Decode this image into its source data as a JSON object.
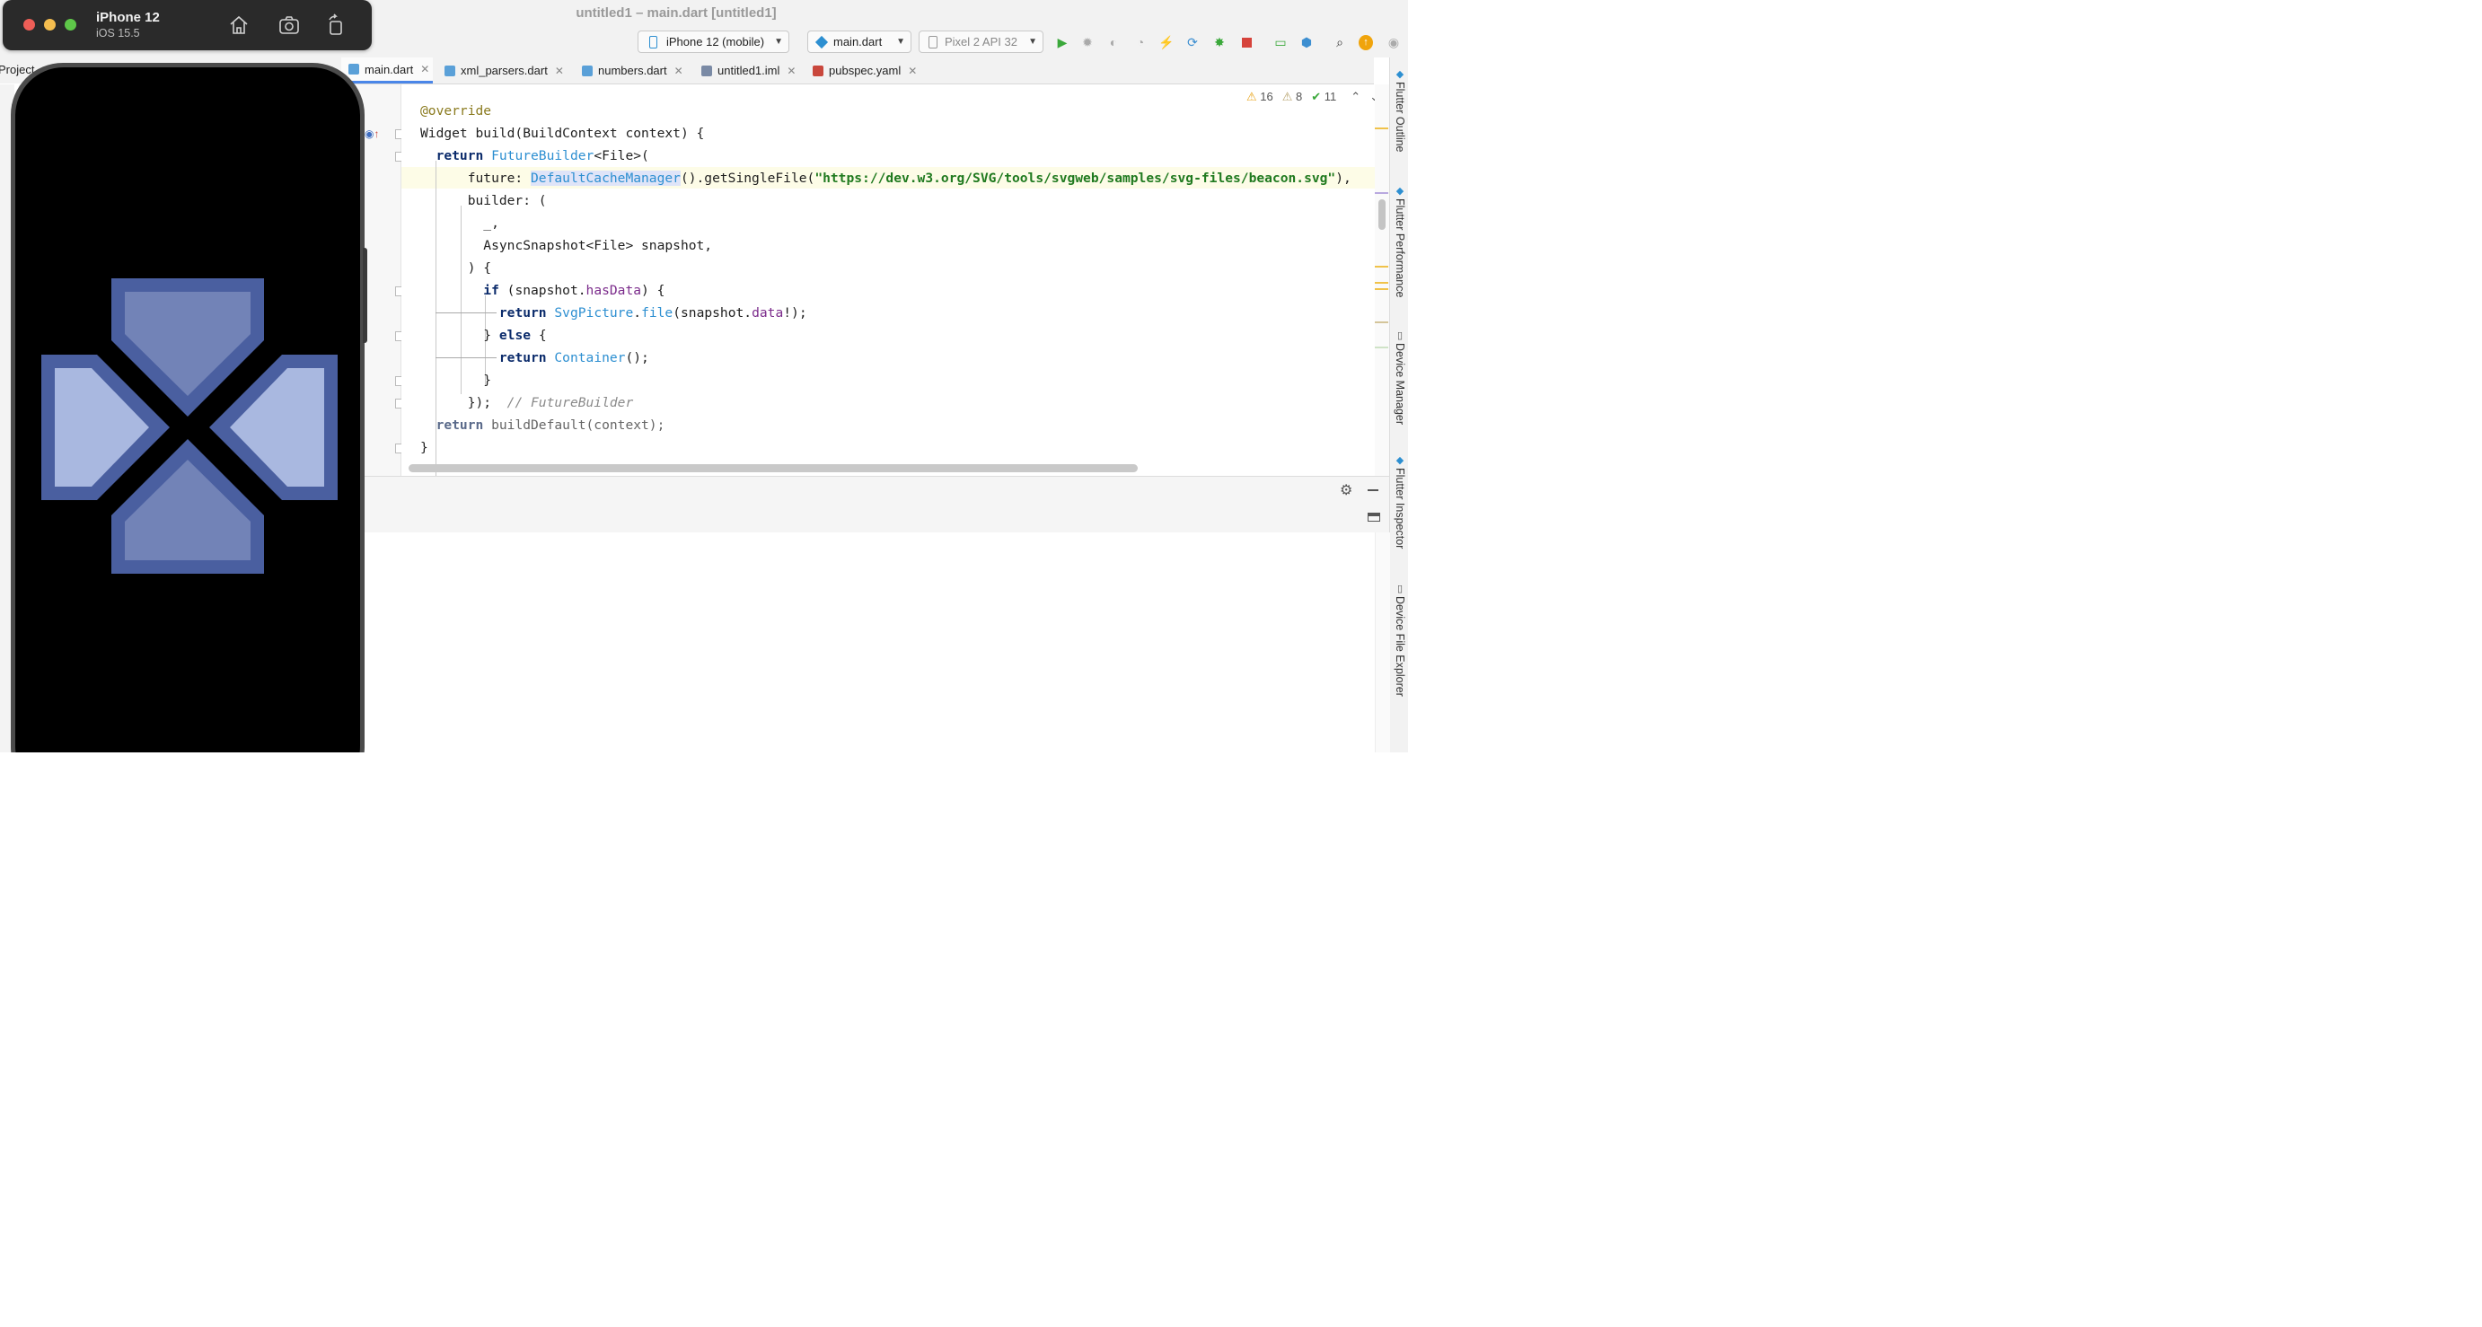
{
  "window": {
    "title": "untitled1 – main.dart [untitled1]"
  },
  "toolbar": {
    "device_combo": "iPhone 12 (mobile)",
    "run_config": "main.dart",
    "emulator": "Pixel 2 API 32"
  },
  "project_panel": {
    "label": "Project"
  },
  "tabs": [
    {
      "label": "main.dart",
      "active": true,
      "close": "✕"
    },
    {
      "label": "xml_parsers.dart",
      "active": false,
      "close": "✕"
    },
    {
      "label": "numbers.dart",
      "active": false,
      "close": "✕"
    },
    {
      "label": "untitled1.iml",
      "active": false,
      "close": "✕"
    },
    {
      "label": "pubspec.yaml",
      "active": false,
      "close": "✕"
    }
  ],
  "inspections": {
    "warnings": "16",
    "weak_warnings": "8",
    "typos": "11"
  },
  "code": {
    "l1_ann": "@override",
    "l2_a": "Widget build(BuildContext context) {",
    "l3_kw": "return",
    "l3_cls": "FutureBuilder",
    "l3_rest": "<File>(",
    "l4_a": "future: ",
    "l4_cls": "DefaultCacheManager",
    "l4_b": "().getSingleFile(",
    "l4_str": "\"https://dev.w3.org/SVG/tools/svgweb/samples/svg-files/beacon.svg\"",
    "l4_c": "),",
    "l5": "builder: (",
    "l6": "_,",
    "l7": "AsyncSnapshot<File> snapshot,",
    "l8": ") {",
    "l9_kw": "if",
    "l9_a": " (snapshot.",
    "l9_fld": "hasData",
    "l9_b": ") {",
    "l10_kw": "return",
    "l10_cls": "SvgPicture",
    "l10_a": ".",
    "l10_cls2": "file",
    "l10_b": "(snapshot.",
    "l10_fld": "data",
    "l10_c": "!);",
    "l11_a": "} ",
    "l11_kw": "else",
    "l11_b": " {",
    "l12_kw": "return",
    "l12_cls": "Container",
    "l12_a": "();",
    "l13": "}",
    "l14_a": "});",
    "l14_cmt": "// FutureBuilder",
    "l15_kw": "return",
    "l15_a": " buildDefault(context);",
    "l16": "}"
  },
  "right_tools": [
    "Flutter Outline",
    "Flutter Performance",
    "Device Manager",
    "Flutter Inspector",
    "Device File Explorer"
  ],
  "simulator": {
    "device": "iPhone 12",
    "os": "iOS 15.5"
  },
  "colors": {
    "beacon_dark": "#4a5fa0",
    "beacon_light": "#a9b8e0",
    "beacon_mid": "#7283b7",
    "accent_blue": "#4a86e8"
  }
}
